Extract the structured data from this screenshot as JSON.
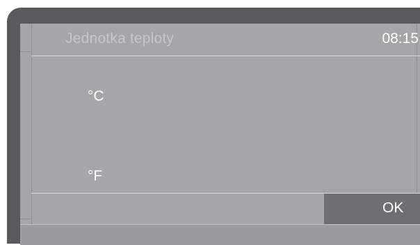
{
  "header": {
    "title": "Jednotka teploty",
    "time": "08:15"
  },
  "options": [
    {
      "label": "°C"
    },
    {
      "label": "°F"
    }
  ],
  "footer": {
    "ok_label": "OK"
  },
  "colors": {
    "device_frame": "#5a5a5c",
    "screen_background": "#a6a6a8",
    "ok_button_background": "#6f6f71",
    "text": "#ffffff",
    "title_text": "#c8c8ca"
  }
}
